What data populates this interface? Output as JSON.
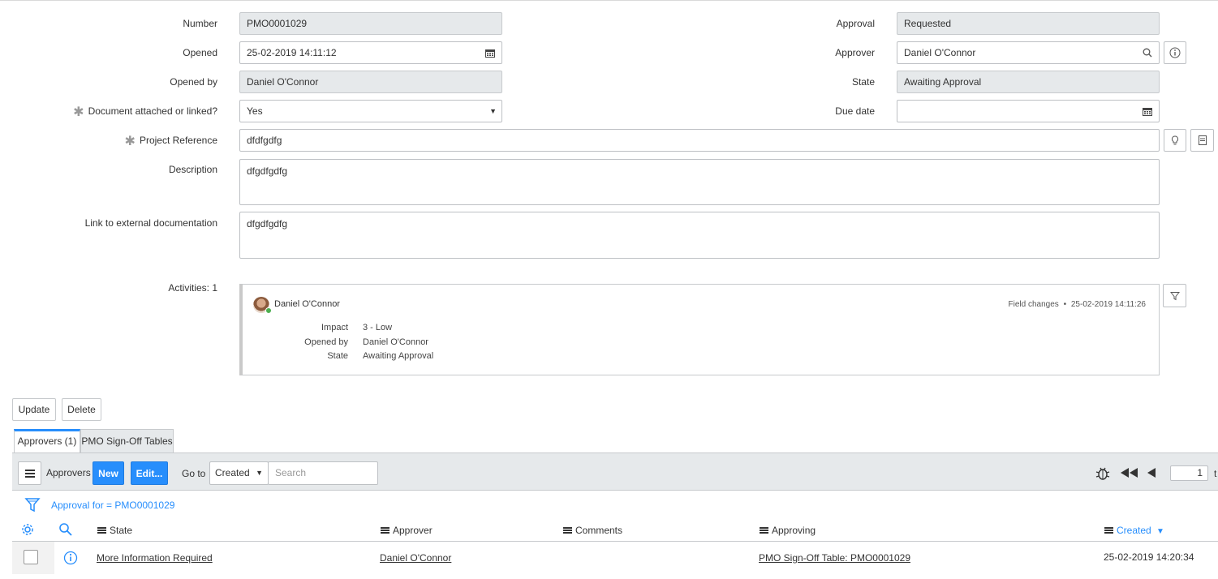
{
  "form": {
    "number": {
      "label": "Number",
      "value": "PMO0001029"
    },
    "opened": {
      "label": "Opened",
      "value": "25-02-2019 14:11:12"
    },
    "opened_by": {
      "label": "Opened by",
      "value": "Daniel O'Connor"
    },
    "document_attached": {
      "label": "Document attached or linked?",
      "value": "Yes"
    },
    "project_reference": {
      "label": "Project Reference",
      "value": "dfdfgdfg"
    },
    "description": {
      "label": "Description",
      "value": "dfgdfgdfg"
    },
    "external_link": {
      "label": "Link to external documentation",
      "value": "dfgdfgdfg"
    },
    "approval": {
      "label": "Approval",
      "value": "Requested"
    },
    "approver": {
      "label": "Approver",
      "value": "Daniel O'Connor"
    },
    "state": {
      "label": "State",
      "value": "Awaiting Approval"
    },
    "due_date": {
      "label": "Due date",
      "value": ""
    },
    "required_marker": "✱"
  },
  "activities": {
    "label": "Activities: 1",
    "entry": {
      "user": "Daniel O'Connor",
      "type": "Field changes",
      "separator": "•",
      "timestamp": "25-02-2019 14:11:26",
      "changes": [
        {
          "field": "Impact",
          "value": "3 - Low"
        },
        {
          "field": "Opened by",
          "value": "Daniel O'Connor"
        },
        {
          "field": "State",
          "value": "Awaiting Approval"
        }
      ]
    }
  },
  "actions": {
    "update": "Update",
    "delete": "Delete"
  },
  "tabs": [
    {
      "label": "Approvers (1)",
      "active": true
    },
    {
      "label": "PMO Sign-Off Tables",
      "active": false
    }
  ],
  "list": {
    "title": "Approvers",
    "new_label": "New",
    "edit_label": "Edit...",
    "goto_label": "Go to",
    "goto_field": "Created",
    "search_placeholder": "Search",
    "page_input": "1",
    "page_suffix": "t",
    "filter_text": "Approval for = PMO0001029",
    "columns": [
      "State",
      "Approver",
      "Comments",
      "Approving",
      "Created"
    ],
    "sort_indicator": "▼",
    "rows": [
      {
        "state": "More Information Required",
        "approver": "Daniel O'Connor",
        "comments": "",
        "approving": "PMO Sign-Off Table: PMO0001029",
        "created": "25-02-2019 14:20:34"
      }
    ]
  },
  "colors": {
    "accent": "#278efc",
    "readonly_bg": "#e6e9eb",
    "online": "#4caf50"
  },
  "icons": [
    "calendar-icon",
    "search-icon",
    "info-icon",
    "lightbulb-icon",
    "reference-icon",
    "filter-icon",
    "hamburger-icon",
    "bug-icon",
    "first-page-icon",
    "prev-page-icon",
    "gear-icon"
  ]
}
